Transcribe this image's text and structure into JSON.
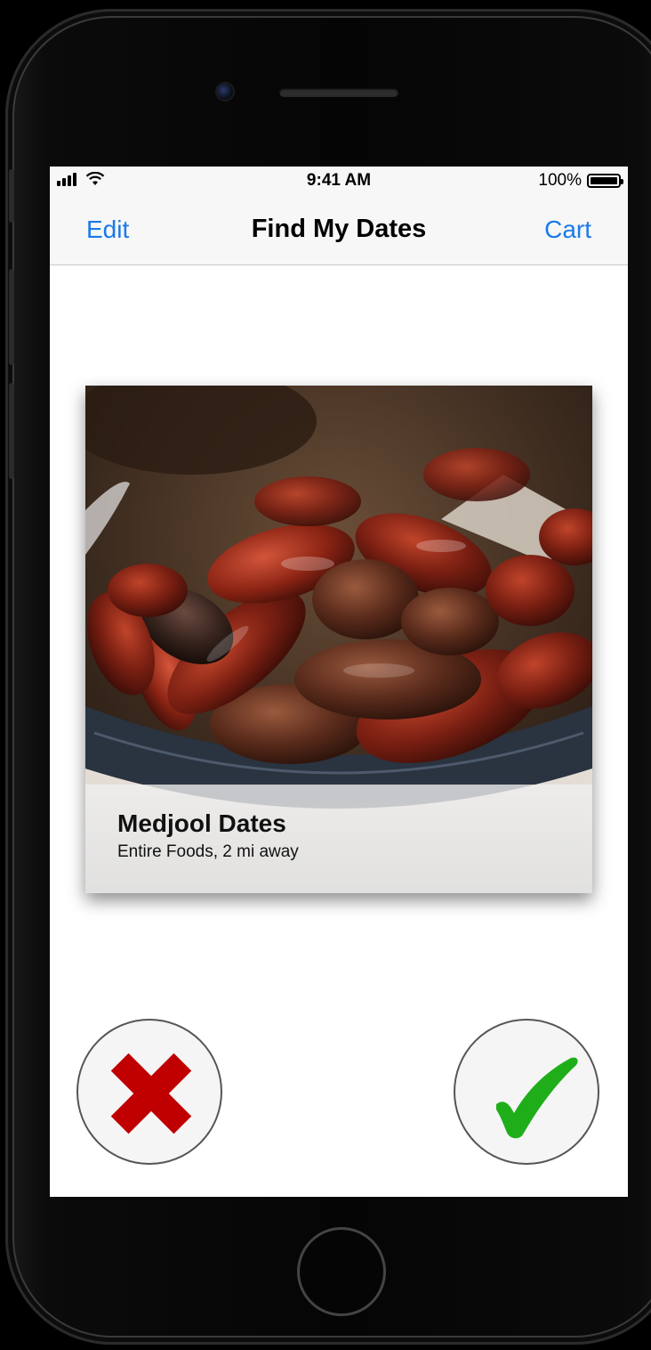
{
  "status_bar": {
    "time": "9:41 AM",
    "battery_text": "100%"
  },
  "nav": {
    "left_label": "Edit",
    "title": "Find My Dates",
    "right_label": "Cart"
  },
  "card": {
    "title": "Medjool Dates",
    "subtitle": "Entire Foods, 2 mi away"
  },
  "colors": {
    "accent": "#1a7ae8",
    "reject": "#c00000",
    "accept": "#1fae1a"
  },
  "icons": {
    "reject": "x-icon",
    "accept": "checkmark-icon"
  }
}
